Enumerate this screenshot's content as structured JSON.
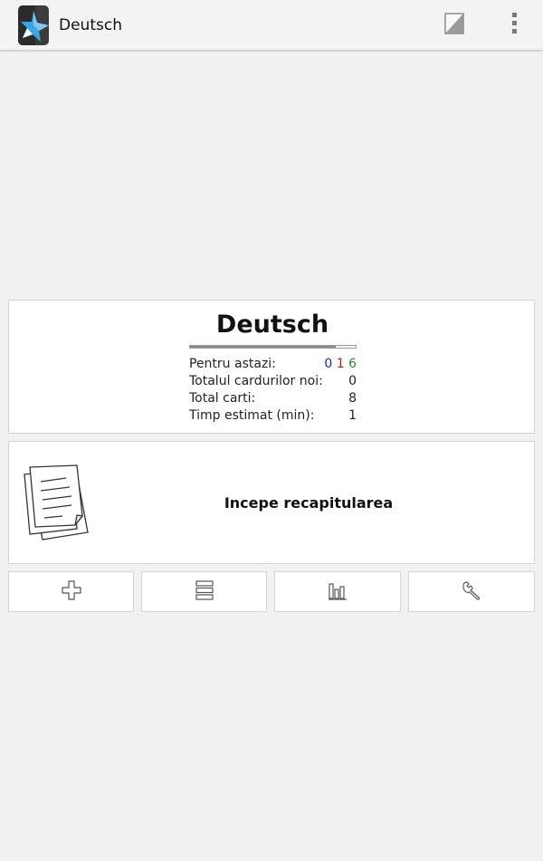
{
  "actionbar": {
    "title": "Deutsch",
    "icons": {
      "app": "anki-star-icon",
      "edit": "edit-note-icon",
      "overflow": "overflow-menu-icon"
    }
  },
  "deck_info": {
    "title": "Deutsch",
    "progress_fraction": 0.88,
    "due_today_label": "Pentru astazi:",
    "due_today": {
      "new": "0",
      "learning": "1",
      "review": "6"
    },
    "new_total_label": "Totalul cardurilor noi:",
    "new_total_value": "0",
    "total_cards_label": "Total carti:",
    "total_cards_value": "8",
    "estimated_time_label": "Timp estimat (min):",
    "estimated_time_value": "1"
  },
  "study": {
    "label": "Incepe recapitularea",
    "icon": "papers-icon"
  },
  "toolbar": {
    "buttons": [
      {
        "icon": "add-icon"
      },
      {
        "icon": "browse-list-icon"
      },
      {
        "icon": "statistics-icon"
      },
      {
        "icon": "wrench-icon"
      }
    ]
  },
  "colors": {
    "background": "#f1f1f1",
    "card": "#ffffff",
    "new_count": "#1e2bb3",
    "learning_count": "#b11c1c",
    "review_count": "#2a8a2a"
  }
}
